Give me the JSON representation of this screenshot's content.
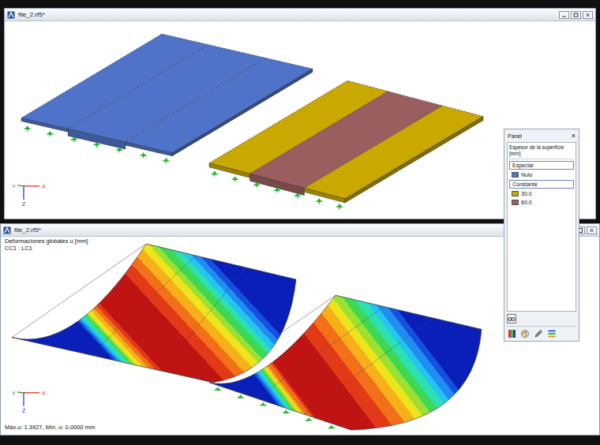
{
  "windows": [
    {
      "title": "file_2.rf5*"
    },
    {
      "title": "file_2.rf5*",
      "result": {
        "title": "Deformaciones globales u [mm]",
        "case": "CC1 : LC1",
        "summary": "Máx.u: 1.3927, Mín. u: 0.0000 mm"
      }
    }
  ],
  "axes": [
    {
      "label": "X",
      "color": "#e02020"
    },
    {
      "label": "Y",
      "color": "#20a020"
    },
    {
      "label": "Z",
      "color": "#2030c0"
    }
  ],
  "panel": {
    "title": "Panel",
    "close": "×",
    "property": "Espesor de la superficie",
    "unit": "[mm]",
    "groups": [
      {
        "label": "Especial",
        "items": [
          {
            "label": "Nulo",
            "color": "#4f73c8"
          }
        ]
      },
      {
        "label": "Constante",
        "items": [
          {
            "label": "30.0",
            "color": "#c9a800"
          },
          {
            "label": "60.0",
            "color": "#9a5e5e"
          }
        ]
      }
    ]
  }
}
